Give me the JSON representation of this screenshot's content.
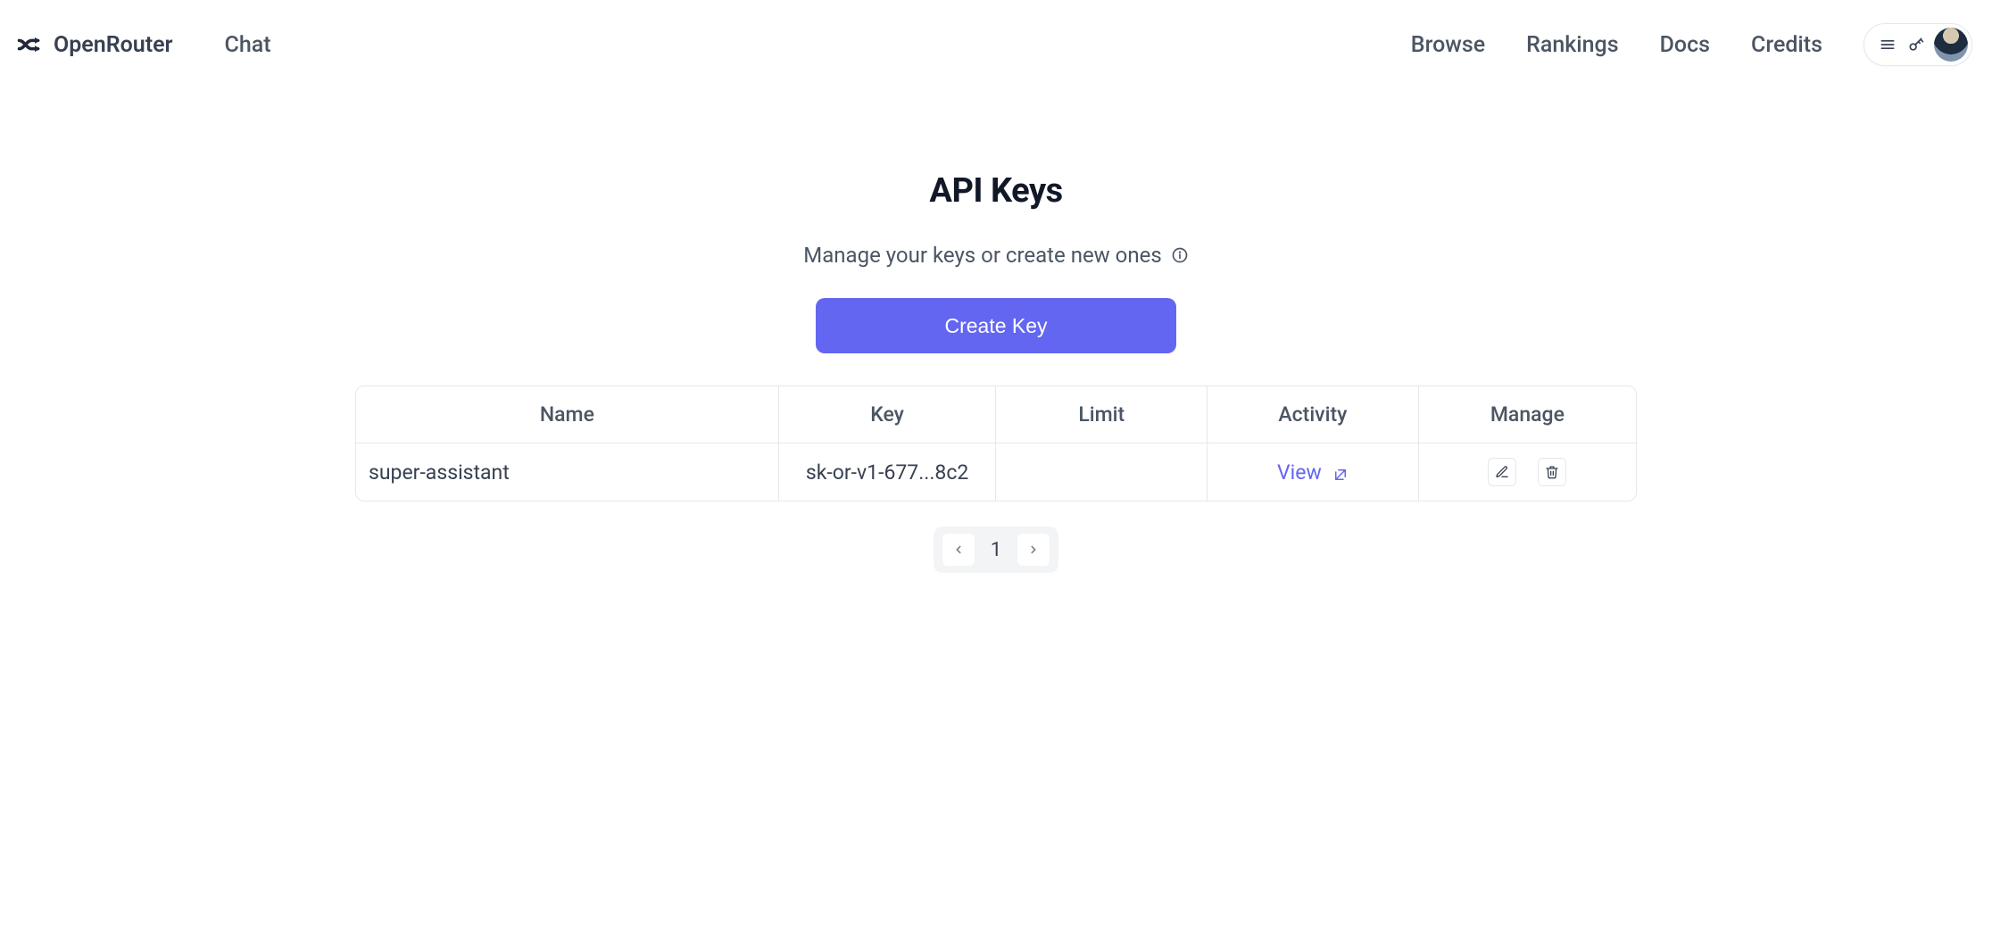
{
  "brand": {
    "name": "OpenRouter"
  },
  "nav": {
    "left": [
      {
        "label": "Chat"
      }
    ],
    "right": [
      {
        "label": "Browse"
      },
      {
        "label": "Rankings"
      },
      {
        "label": "Docs"
      },
      {
        "label": "Credits"
      }
    ]
  },
  "page": {
    "title": "API Keys",
    "subtitle": "Manage your keys or create new ones",
    "create_button_label": "Create Key"
  },
  "table": {
    "headers": {
      "name": "Name",
      "key": "Key",
      "limit": "Limit",
      "activity": "Activity",
      "manage": "Manage"
    },
    "rows": [
      {
        "name": "super-assistant",
        "key": "sk-or-v1-677...8c2",
        "limit": "",
        "activity_label": "View"
      }
    ]
  },
  "pagination": {
    "current_page": "1"
  }
}
